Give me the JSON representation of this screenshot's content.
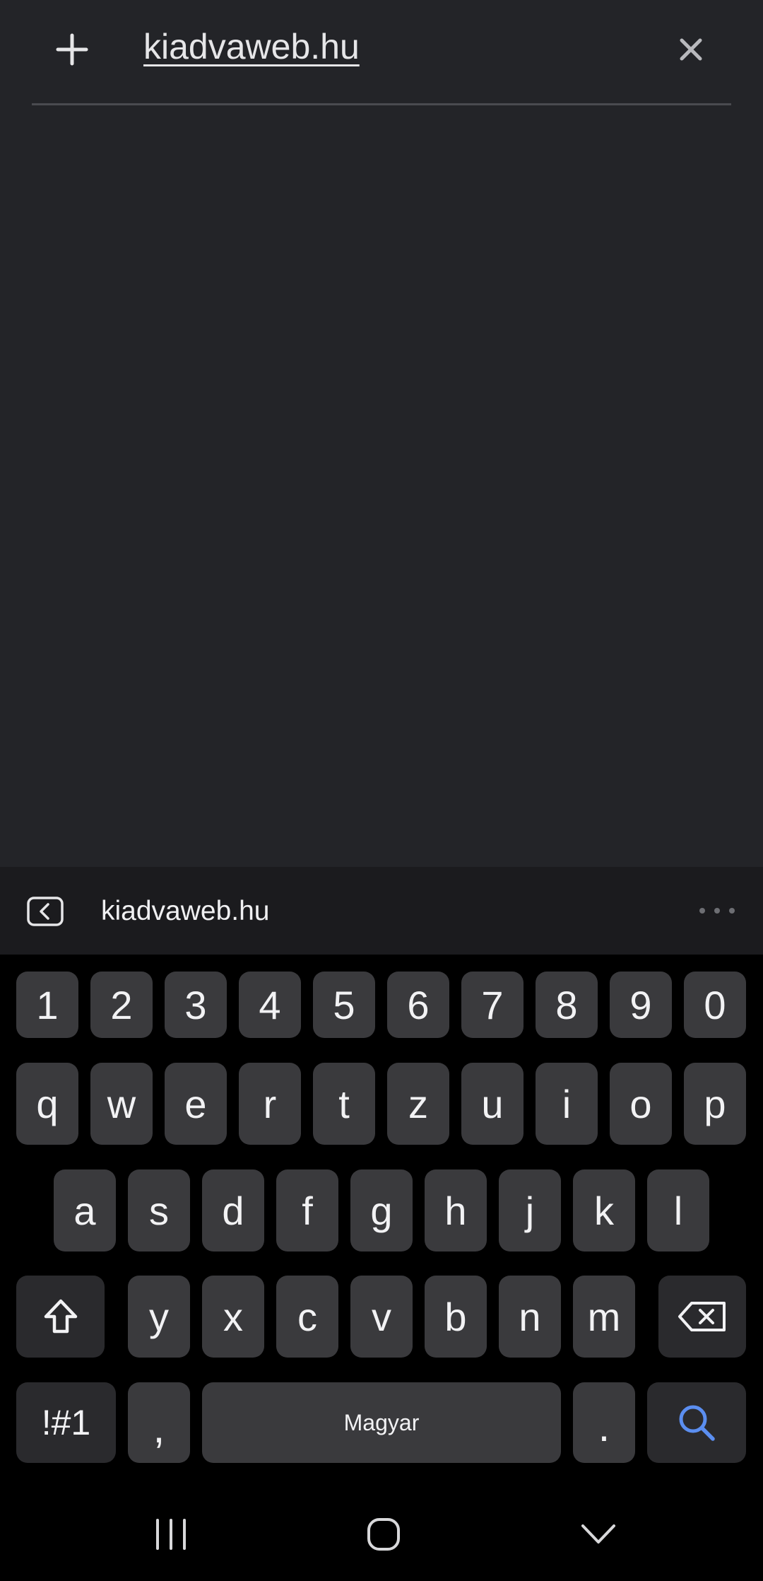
{
  "address_bar": {
    "url": "kiadvaweb.hu",
    "add_icon": "plus-icon",
    "clear_icon": "close-icon"
  },
  "suggestion_strip": {
    "back_icon": "keyboard-back-icon",
    "suggestion": "kiadvaweb.hu",
    "more_icon": "more-horizontal-icon"
  },
  "keyboard": {
    "number_row": [
      "1",
      "2",
      "3",
      "4",
      "5",
      "6",
      "7",
      "8",
      "9",
      "0"
    ],
    "row1": [
      "q",
      "w",
      "e",
      "r",
      "t",
      "z",
      "u",
      "i",
      "o",
      "p"
    ],
    "row2": [
      "a",
      "s",
      "d",
      "f",
      "g",
      "h",
      "j",
      "k",
      "l"
    ],
    "row3": [
      "y",
      "x",
      "c",
      "v",
      "b",
      "n",
      "m"
    ],
    "shift_icon": "shift-icon",
    "backspace_icon": "backspace-icon",
    "symbols_label": "!#1",
    "comma_label": ",",
    "space_label": "Magyar",
    "period_label": ".",
    "search_icon": "search-icon",
    "accent_color": "#5b8ef0"
  },
  "navbar": {
    "recents_icon": "recents-icon",
    "home_icon": "home-icon",
    "hide_keyboard_icon": "chevron-down-icon"
  }
}
